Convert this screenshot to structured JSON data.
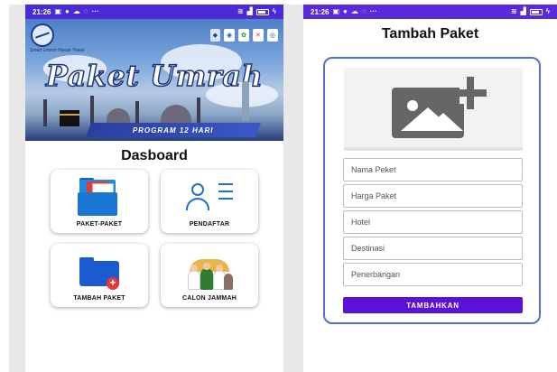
{
  "left_screen": {
    "status": {
      "time": "21:26",
      "icons": [
        "sim-icon",
        "circle-icon",
        "cloud-icon",
        "whatsapp-icon",
        "more-icon"
      ],
      "right_icons": [
        "wifi-icon",
        "signal-icon",
        "battery-icon",
        "charging-icon"
      ]
    },
    "banner": {
      "title": "Paket Umrah",
      "program": "PROGRAM 12 HARI",
      "brand_text": "Smart Umroh Hasan Travel"
    },
    "page_title": "Dasboard",
    "menu": [
      {
        "label": "PAKET-PAKET",
        "icon": "folder-documents-icon"
      },
      {
        "label": "PENDAFTAR",
        "icon": "user-list-icon"
      },
      {
        "label": "TAMBAH PAKET",
        "icon": "folder-add-icon"
      },
      {
        "label": "CALON JAMMAH",
        "icon": "pilgrims-icon"
      }
    ]
  },
  "right_screen": {
    "status": {
      "time": "21:26"
    },
    "page_title": "Tambah Paket",
    "image_picker": {
      "icon": "add-image-icon"
    },
    "fields": [
      {
        "placeholder": "Nama Peket",
        "value": ""
      },
      {
        "placeholder": "Harga Paket",
        "value": ""
      },
      {
        "placeholder": "Hotel",
        "value": ""
      },
      {
        "placeholder": "Destinasi",
        "value": ""
      },
      {
        "placeholder": "Penerbangan",
        "value": ""
      }
    ],
    "submit_label": "TAMBAHKAN"
  },
  "colors": {
    "status_bar": "#4a2bd6",
    "accent": "#5b12d6",
    "card_border": "#5570c9",
    "icon_blue": "#1e6fd6",
    "icon_red": "#e53935"
  }
}
